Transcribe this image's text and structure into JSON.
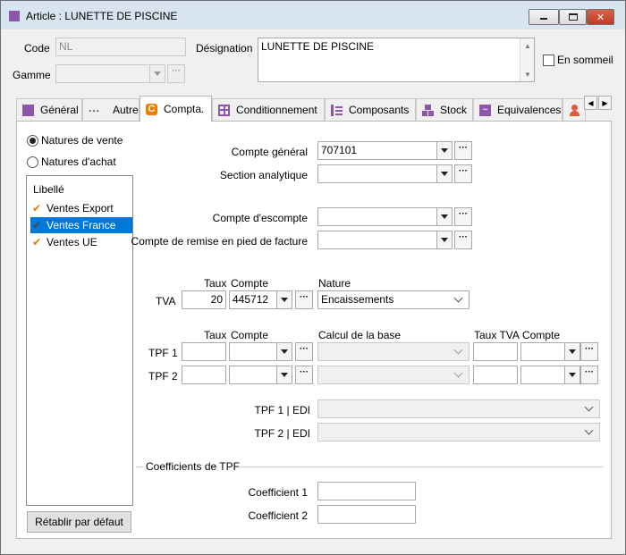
{
  "window": {
    "title": "Article : LUNETTE DE PISCINE"
  },
  "header": {
    "code_label": "Code",
    "code_value": "NL",
    "gamme_label": "Gamme",
    "designation_label": "Désignation",
    "designation_value": "LUNETTE DE PISCINE",
    "sommeil_label": "En sommeil"
  },
  "tabs": [
    {
      "label": "Général",
      "icon": "square-purple-icon"
    },
    {
      "label": "Autre",
      "icon": "ellipsis-icon"
    },
    {
      "label": "Compta.",
      "icon": "compta-icon",
      "active": true
    },
    {
      "label": "Conditionnement",
      "icon": "grid-icon"
    },
    {
      "label": "Composants",
      "icon": "tree-icon"
    },
    {
      "label": "Stock",
      "icon": "boxes-icon"
    },
    {
      "label": "Equivalences",
      "icon": "wave-icon"
    }
  ],
  "natures": {
    "vente_label": "Natures de vente",
    "achat_label": "Natures d'achat",
    "list_header": "Libellé",
    "items": [
      "Ventes Export",
      "Ventes France",
      "Ventes UE"
    ],
    "selected_index": 1,
    "reset_button": "Rétablir par défaut"
  },
  "accounts": {
    "compte_general_label": "Compte général",
    "compte_general_value": "707101",
    "section_analytique_label": "Section analytique",
    "compte_escompte_label": "Compte d'escompte",
    "compte_remise_label": "Compte de remise en pied de facture"
  },
  "tva": {
    "row_label": "TVA",
    "taux_header": "Taux",
    "compte_header": "Compte",
    "nature_header": "Nature",
    "taux_value": "20",
    "compte_value": "445712",
    "nature_value": "Encaissements"
  },
  "tpf": {
    "taux_header": "Taux",
    "compte_header": "Compte",
    "calcul_header": "Calcul de la base",
    "taux_tva_header": "Taux TVA",
    "compte2_header": "Compte",
    "row1_label": "TPF 1",
    "row2_label": "TPF 2",
    "edi1_label": "TPF 1 | EDI",
    "edi2_label": "TPF 2 | EDI"
  },
  "coefficients": {
    "section_title": "Coefficients de TPF",
    "coef1_label": "Coefficient 1",
    "coef2_label": "Coefficient 2"
  }
}
